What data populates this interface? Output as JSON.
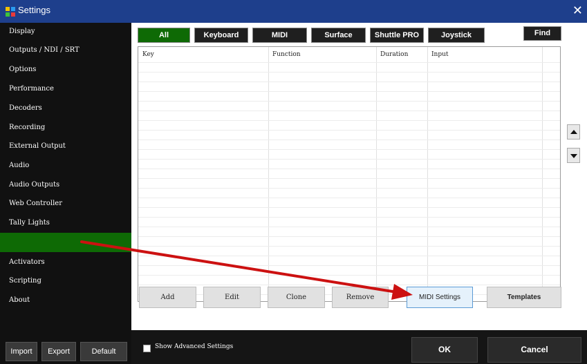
{
  "window": {
    "title": "Settings",
    "close_glyph": "✕"
  },
  "sidebar": {
    "items": [
      {
        "label": "Display"
      },
      {
        "label": "Outputs / NDI / SRT"
      },
      {
        "label": "Options"
      },
      {
        "label": "Performance"
      },
      {
        "label": "Decoders"
      },
      {
        "label": "Recording"
      },
      {
        "label": "External Output"
      },
      {
        "label": "Audio"
      },
      {
        "label": "Audio Outputs"
      },
      {
        "label": "Web Controller"
      },
      {
        "label": "Tally Lights"
      },
      {
        "label": "",
        "active": true
      },
      {
        "label": "Activators"
      },
      {
        "label": "Scripting"
      },
      {
        "label": "About"
      }
    ],
    "bottom_buttons": {
      "import": "Import",
      "export": "Export",
      "default": "Default"
    }
  },
  "tabs": [
    {
      "label": "All",
      "active": true
    },
    {
      "label": "Keyboard"
    },
    {
      "label": "MIDI"
    },
    {
      "label": "Surface"
    },
    {
      "label": "Shuttle PRO"
    },
    {
      "label": "Joystick"
    }
  ],
  "find_label": "Find",
  "table": {
    "columns": [
      "Key",
      "Function",
      "Duration",
      "Input"
    ],
    "rows": []
  },
  "scroll": {
    "up_icon": "triangle-up-icon",
    "down_icon": "triangle-down-icon"
  },
  "actions": {
    "add": "Add",
    "edit": "Edit",
    "clone": "Clone",
    "remove": "Remove",
    "midi_settings": "MIDI Settings",
    "templates": "Templates"
  },
  "footer": {
    "show_advanced": "Show Advanced Settings",
    "show_advanced_checked": false,
    "ok": "OK",
    "cancel": "Cancel"
  },
  "colors": {
    "title_bar": "#1e3f8c",
    "active_green": "#0e6a05",
    "annotation_arrow": "#cc1111"
  }
}
